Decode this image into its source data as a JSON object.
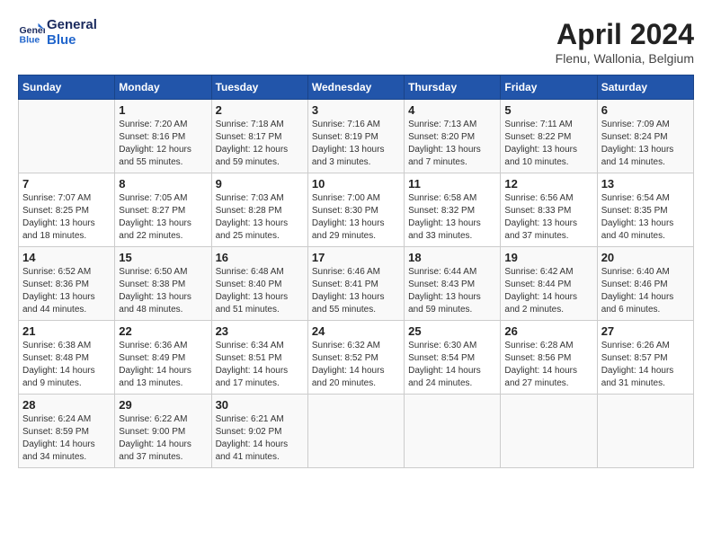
{
  "header": {
    "logo_line1": "General",
    "logo_line2": "Blue",
    "month_year": "April 2024",
    "location": "Flenu, Wallonia, Belgium"
  },
  "weekdays": [
    "Sunday",
    "Monday",
    "Tuesday",
    "Wednesday",
    "Thursday",
    "Friday",
    "Saturday"
  ],
  "weeks": [
    [
      {
        "day": "",
        "info": ""
      },
      {
        "day": "1",
        "info": "Sunrise: 7:20 AM\nSunset: 8:16 PM\nDaylight: 12 hours\nand 55 minutes."
      },
      {
        "day": "2",
        "info": "Sunrise: 7:18 AM\nSunset: 8:17 PM\nDaylight: 12 hours\nand 59 minutes."
      },
      {
        "day": "3",
        "info": "Sunrise: 7:16 AM\nSunset: 8:19 PM\nDaylight: 13 hours\nand 3 minutes."
      },
      {
        "day": "4",
        "info": "Sunrise: 7:13 AM\nSunset: 8:20 PM\nDaylight: 13 hours\nand 7 minutes."
      },
      {
        "day": "5",
        "info": "Sunrise: 7:11 AM\nSunset: 8:22 PM\nDaylight: 13 hours\nand 10 minutes."
      },
      {
        "day": "6",
        "info": "Sunrise: 7:09 AM\nSunset: 8:24 PM\nDaylight: 13 hours\nand 14 minutes."
      }
    ],
    [
      {
        "day": "7",
        "info": "Sunrise: 7:07 AM\nSunset: 8:25 PM\nDaylight: 13 hours\nand 18 minutes."
      },
      {
        "day": "8",
        "info": "Sunrise: 7:05 AM\nSunset: 8:27 PM\nDaylight: 13 hours\nand 22 minutes."
      },
      {
        "day": "9",
        "info": "Sunrise: 7:03 AM\nSunset: 8:28 PM\nDaylight: 13 hours\nand 25 minutes."
      },
      {
        "day": "10",
        "info": "Sunrise: 7:00 AM\nSunset: 8:30 PM\nDaylight: 13 hours\nand 29 minutes."
      },
      {
        "day": "11",
        "info": "Sunrise: 6:58 AM\nSunset: 8:32 PM\nDaylight: 13 hours\nand 33 minutes."
      },
      {
        "day": "12",
        "info": "Sunrise: 6:56 AM\nSunset: 8:33 PM\nDaylight: 13 hours\nand 37 minutes."
      },
      {
        "day": "13",
        "info": "Sunrise: 6:54 AM\nSunset: 8:35 PM\nDaylight: 13 hours\nand 40 minutes."
      }
    ],
    [
      {
        "day": "14",
        "info": "Sunrise: 6:52 AM\nSunset: 8:36 PM\nDaylight: 13 hours\nand 44 minutes."
      },
      {
        "day": "15",
        "info": "Sunrise: 6:50 AM\nSunset: 8:38 PM\nDaylight: 13 hours\nand 48 minutes."
      },
      {
        "day": "16",
        "info": "Sunrise: 6:48 AM\nSunset: 8:40 PM\nDaylight: 13 hours\nand 51 minutes."
      },
      {
        "day": "17",
        "info": "Sunrise: 6:46 AM\nSunset: 8:41 PM\nDaylight: 13 hours\nand 55 minutes."
      },
      {
        "day": "18",
        "info": "Sunrise: 6:44 AM\nSunset: 8:43 PM\nDaylight: 13 hours\nand 59 minutes."
      },
      {
        "day": "19",
        "info": "Sunrise: 6:42 AM\nSunset: 8:44 PM\nDaylight: 14 hours\nand 2 minutes."
      },
      {
        "day": "20",
        "info": "Sunrise: 6:40 AM\nSunset: 8:46 PM\nDaylight: 14 hours\nand 6 minutes."
      }
    ],
    [
      {
        "day": "21",
        "info": "Sunrise: 6:38 AM\nSunset: 8:48 PM\nDaylight: 14 hours\nand 9 minutes."
      },
      {
        "day": "22",
        "info": "Sunrise: 6:36 AM\nSunset: 8:49 PM\nDaylight: 14 hours\nand 13 minutes."
      },
      {
        "day": "23",
        "info": "Sunrise: 6:34 AM\nSunset: 8:51 PM\nDaylight: 14 hours\nand 17 minutes."
      },
      {
        "day": "24",
        "info": "Sunrise: 6:32 AM\nSunset: 8:52 PM\nDaylight: 14 hours\nand 20 minutes."
      },
      {
        "day": "25",
        "info": "Sunrise: 6:30 AM\nSunset: 8:54 PM\nDaylight: 14 hours\nand 24 minutes."
      },
      {
        "day": "26",
        "info": "Sunrise: 6:28 AM\nSunset: 8:56 PM\nDaylight: 14 hours\nand 27 minutes."
      },
      {
        "day": "27",
        "info": "Sunrise: 6:26 AM\nSunset: 8:57 PM\nDaylight: 14 hours\nand 31 minutes."
      }
    ],
    [
      {
        "day": "28",
        "info": "Sunrise: 6:24 AM\nSunset: 8:59 PM\nDaylight: 14 hours\nand 34 minutes."
      },
      {
        "day": "29",
        "info": "Sunrise: 6:22 AM\nSunset: 9:00 PM\nDaylight: 14 hours\nand 37 minutes."
      },
      {
        "day": "30",
        "info": "Sunrise: 6:21 AM\nSunset: 9:02 PM\nDaylight: 14 hours\nand 41 minutes."
      },
      {
        "day": "",
        "info": ""
      },
      {
        "day": "",
        "info": ""
      },
      {
        "day": "",
        "info": ""
      },
      {
        "day": "",
        "info": ""
      }
    ]
  ]
}
